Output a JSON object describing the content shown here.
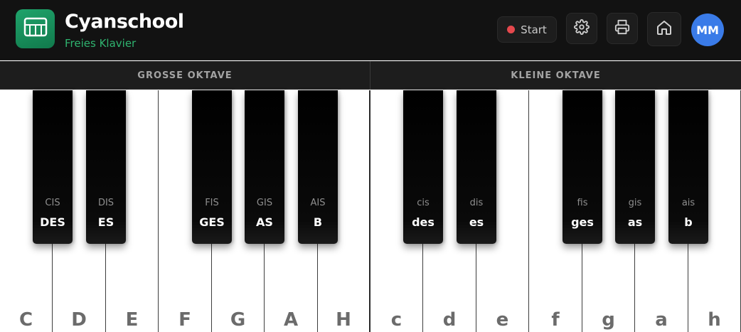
{
  "header": {
    "app_title": "Cyanschool",
    "app_subtitle": "Freies Klavier",
    "start_label": "Start",
    "avatar_initials": "MM",
    "icons": [
      "piano-icon",
      "record-dot-icon",
      "gear-icon",
      "printer-icon",
      "home-icon"
    ]
  },
  "octaves": [
    "GROSSE OKTAVE",
    "KLEINE OKTAVE"
  ],
  "white_keys": [
    "C",
    "D",
    "E",
    "F",
    "G",
    "A",
    "H",
    "c",
    "d",
    "e",
    "f",
    "g",
    "a",
    "h"
  ],
  "black_keys": [
    {
      "sharp": "CIS",
      "flat": "DES"
    },
    {
      "sharp": "DIS",
      "flat": "ES"
    },
    {
      "sharp": "FIS",
      "flat": "GES"
    },
    {
      "sharp": "GIS",
      "flat": "AS"
    },
    {
      "sharp": "AIS",
      "flat": "B"
    },
    {
      "sharp": "cis",
      "flat": "des"
    },
    {
      "sharp": "dis",
      "flat": "es"
    },
    {
      "sharp": "fis",
      "flat": "ges"
    },
    {
      "sharp": "gis",
      "flat": "as"
    },
    {
      "sharp": "ais",
      "flat": "b"
    }
  ],
  "colors": {
    "header_bg": "#121212",
    "accent_green": "#2fb36f",
    "record_red": "#e5484d",
    "avatar_blue": "#3a7be8"
  }
}
